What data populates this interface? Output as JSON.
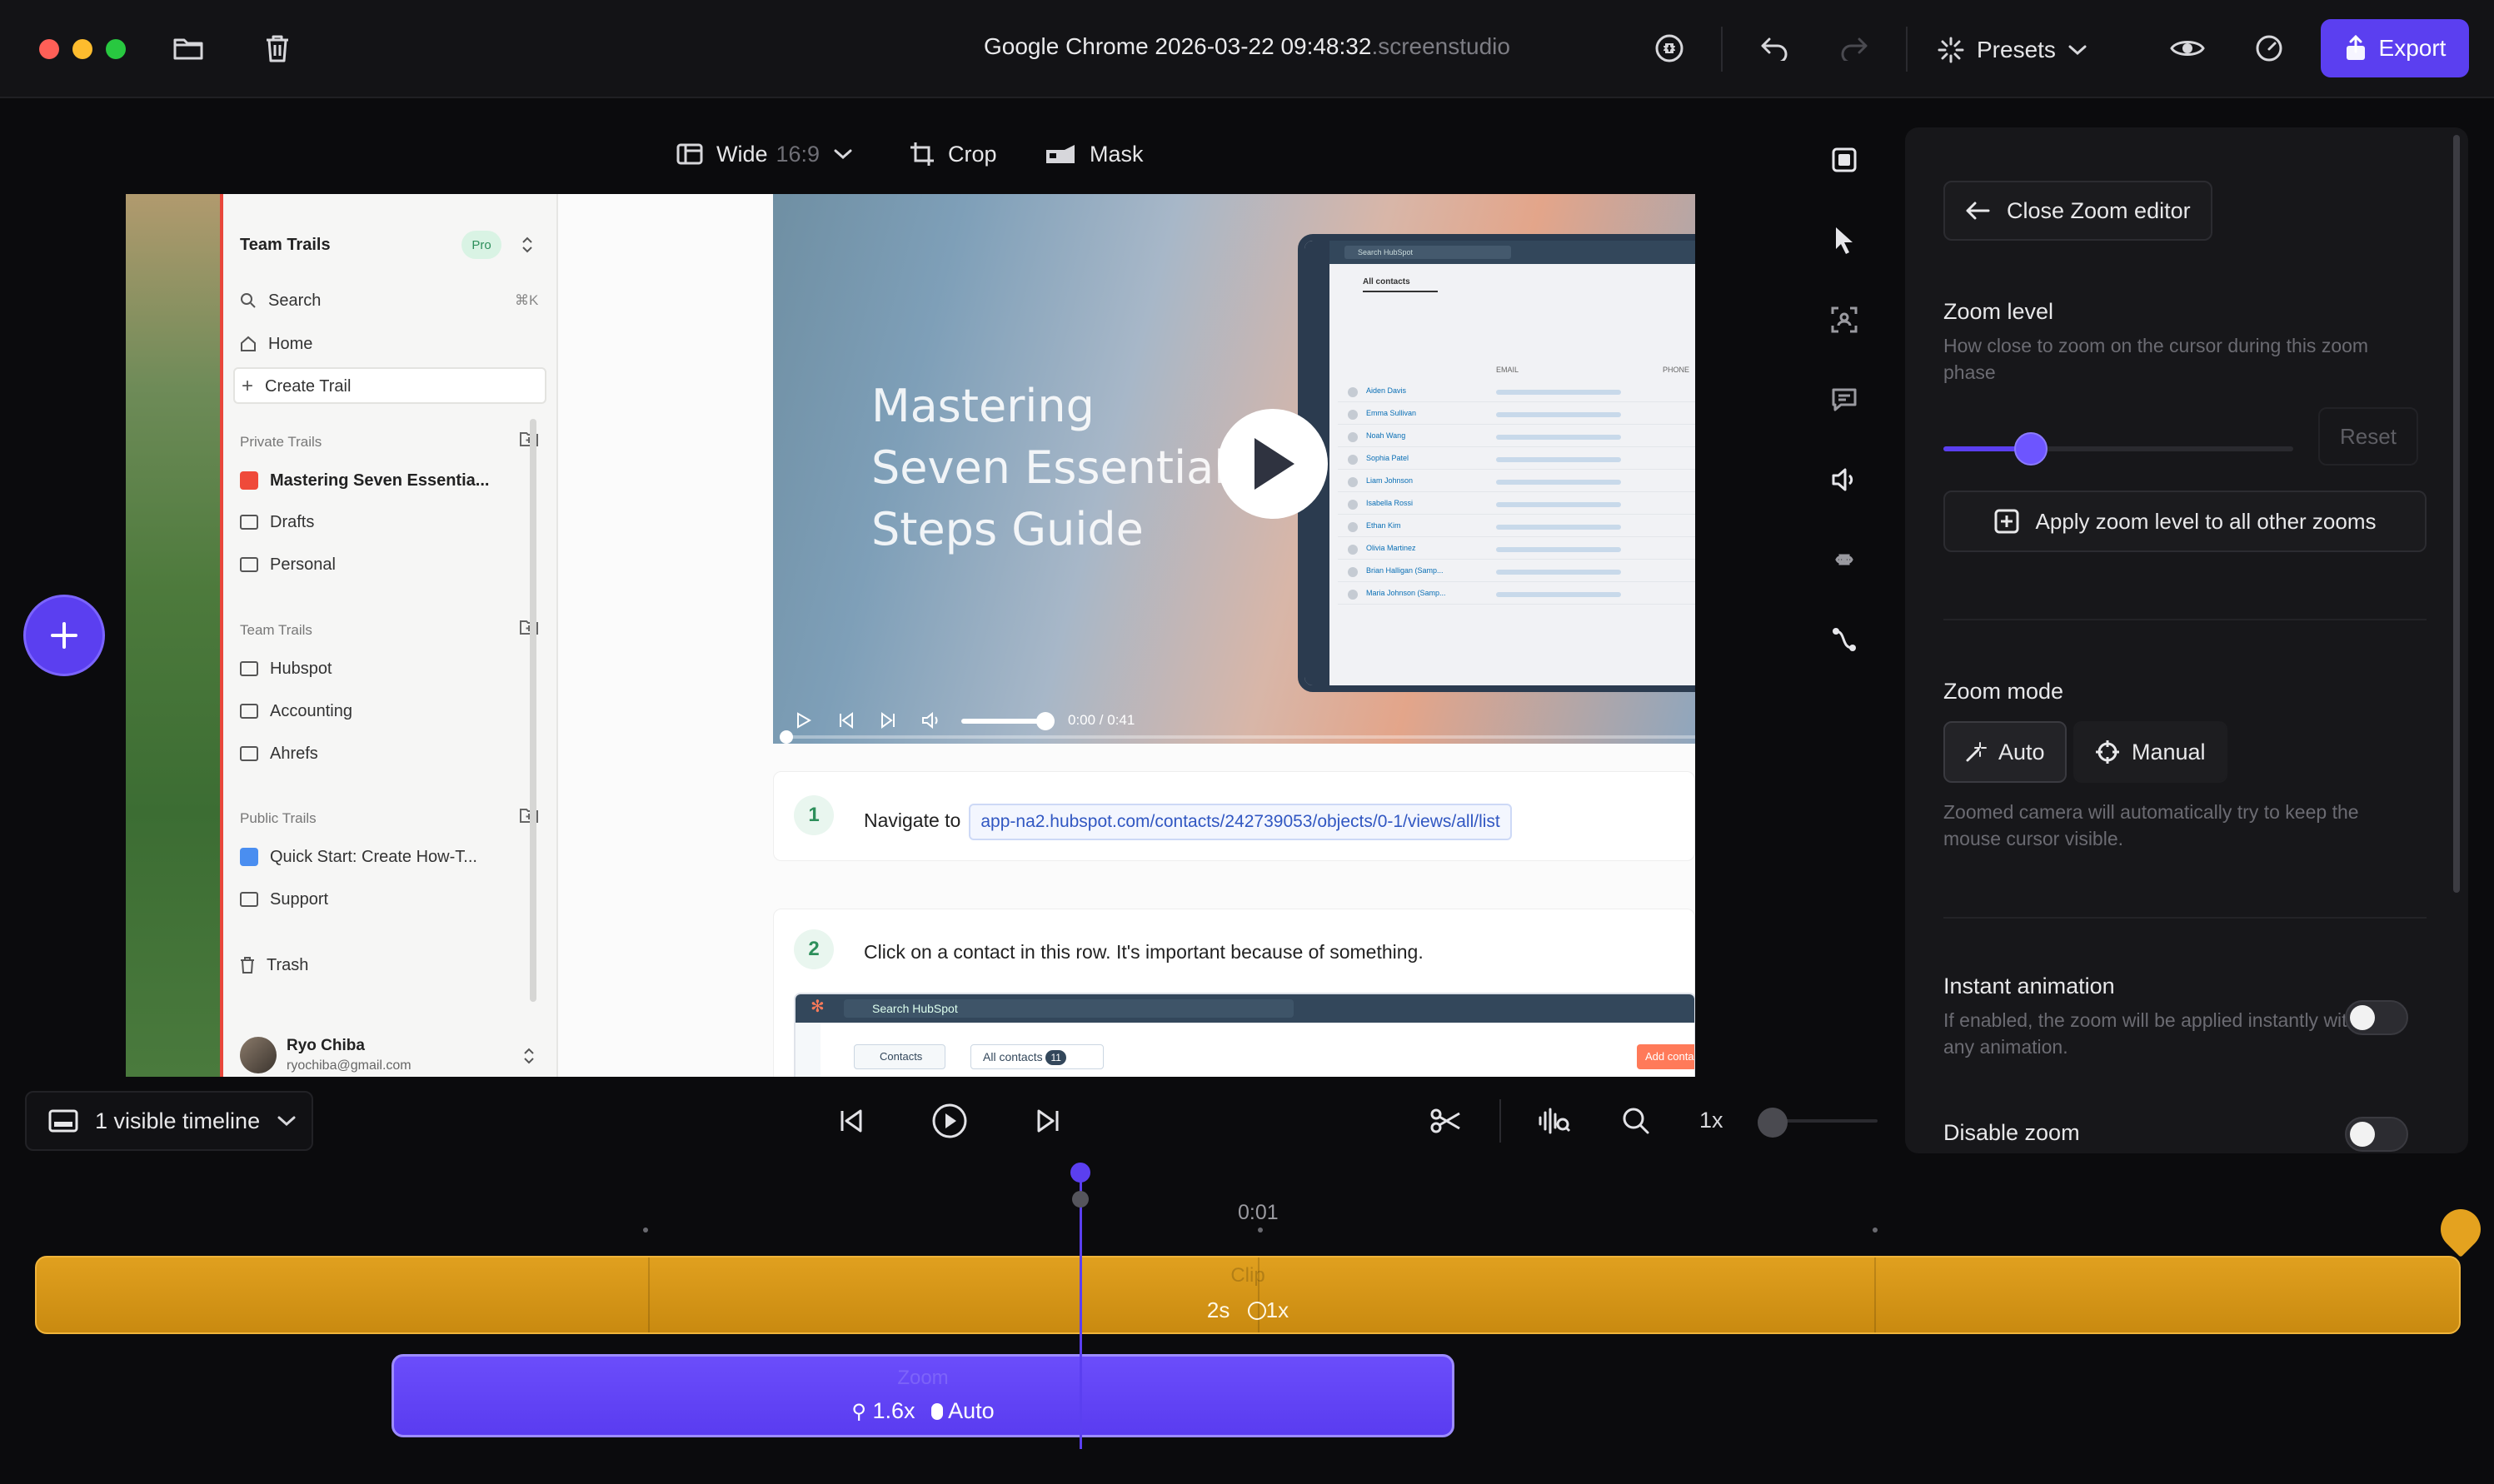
{
  "window": {
    "title": "Google Chrome 2026-03-22 09:48:32",
    "title_ext": ".screenstudio",
    "presets_label": "Presets",
    "export_label": "Export"
  },
  "canvas_toolbar": {
    "aspect_label": "Wide",
    "aspect_ratio": "16:9",
    "crop_label": "Crop",
    "mask_label": "Mask"
  },
  "app_sidebar": {
    "workspace": "Team Trails",
    "plan_badge": "Pro",
    "search_label": "Search",
    "search_shortcut": "⌘K",
    "home_label": "Home",
    "create_label": "Create Trail",
    "private_section": "Private Trails",
    "private_items": [
      "Mastering Seven Essentia...",
      "Drafts",
      "Personal"
    ],
    "team_section": "Team Trails",
    "team_items": [
      "Hubspot",
      "Accounting",
      "Ahrefs"
    ],
    "public_section": "Public Trails",
    "public_items": [
      "Quick Start: Create How-T...",
      "Support"
    ],
    "trash_label": "Trash",
    "user_name": "Ryo Chiba",
    "user_email": "ryochiba@gmail.com"
  },
  "video": {
    "title_lines": [
      "Mastering",
      "Seven Essential",
      "Steps Guide"
    ],
    "time": "0:00 / 0:41",
    "mini_search": "Search HubSpot",
    "mini_tab": "All contacts",
    "mini_email_header": "EMAIL",
    "mini_phone_header": "PHONE",
    "mini_contacts": [
      "Aiden Davis",
      "Emma Sullivan",
      "Noah Wang",
      "Sophia Patel",
      "Liam Johnson",
      "Isabella Rossi",
      "Ethan Kim",
      "Olivia Martinez",
      "Brian Halligan (Samp...",
      "Maria Johnson (Samp..."
    ]
  },
  "steps": [
    {
      "num": "1",
      "text": "Navigate to",
      "url": "app-na2.hubspot.com/contacts/242739053/objects/0-1/views/all/list"
    },
    {
      "num": "2",
      "text": "Click on a contact in this row. It's important because of something."
    }
  ],
  "step2_screen": {
    "search": "Search HubSpot",
    "contacts_btn": "Contacts",
    "tab": "All contacts",
    "tab_count": "11",
    "add_button": "Add conta"
  },
  "panel": {
    "close_label": "Close Zoom editor",
    "zoom_level_title": "Zoom level",
    "zoom_level_desc": "How close to zoom on the cursor during this zoom phase",
    "zoom_level_value": 0.25,
    "reset_label": "Reset",
    "apply_label": "Apply zoom level to all other zooms",
    "zoom_mode_title": "Zoom mode",
    "mode_auto": "Auto",
    "mode_manual": "Manual",
    "zoom_mode_desc": "Zoomed camera will automatically try to keep the mouse cursor visible.",
    "instant_title": "Instant animation",
    "instant_desc": "If enabled, the zoom will be applied instantly without any animation.",
    "instant_on": false,
    "disable_title": "Disable zoom",
    "disable_on": false
  },
  "timeline": {
    "visible_label": "1 visible timeline",
    "speed_label": "1x",
    "ruler_label": "0:01",
    "clip_label": "Clip",
    "clip_duration": "2s",
    "clip_speed": "1x",
    "zoom_label": "Zoom",
    "zoom_value": "1.6x",
    "zoom_mode": "Auto"
  },
  "colors": {
    "accent": "#5b3ff0",
    "clip": "#d99a18",
    "zoom": "#6246f6"
  }
}
